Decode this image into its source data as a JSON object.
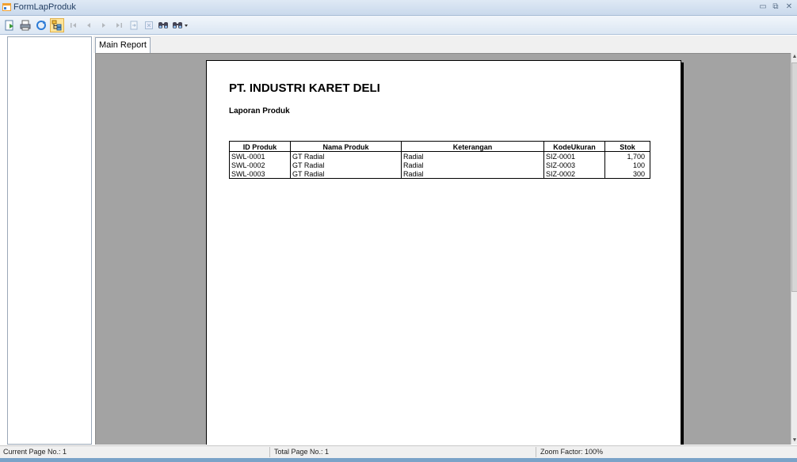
{
  "window": {
    "title": "FormLapProduk"
  },
  "toolbar": {
    "buttons": [
      {
        "icon": "export-icon"
      },
      {
        "icon": "print-icon"
      },
      {
        "icon": "refresh-icon"
      },
      {
        "icon": "toggle-group-tree-icon"
      },
      {
        "icon": "first-page-icon"
      },
      {
        "icon": "previous-page-icon"
      },
      {
        "icon": "next-page-icon"
      },
      {
        "icon": "last-page-icon"
      },
      {
        "icon": "goto-page-icon"
      },
      {
        "icon": "close-view-icon"
      },
      {
        "icon": "find-icon"
      },
      {
        "icon": "zoom-icon"
      }
    ]
  },
  "tabs": [
    {
      "label": "Main Report"
    }
  ],
  "report": {
    "company": "PT. INDUSTRI KARET DELI",
    "subtitle": "Laporan Produk",
    "columns": [
      "ID Produk",
      "Nama Produk",
      "Keterangan",
      "KodeUkuran",
      "Stok"
    ],
    "rows": [
      [
        "SWL-0001",
        "GT Radial",
        "Radial",
        "SIZ-0001",
        "1,700"
      ],
      [
        "SWL-0002",
        "GT Radial",
        "Radial",
        "SIZ-0003",
        "100"
      ],
      [
        "SWL-0003",
        "GT Radial",
        "Radial",
        "SIZ-0002",
        "300"
      ]
    ]
  },
  "status": {
    "current_page": "Current Page No.: 1",
    "total_page": "Total Page No.: 1",
    "zoom": "Zoom Factor: 100%"
  }
}
